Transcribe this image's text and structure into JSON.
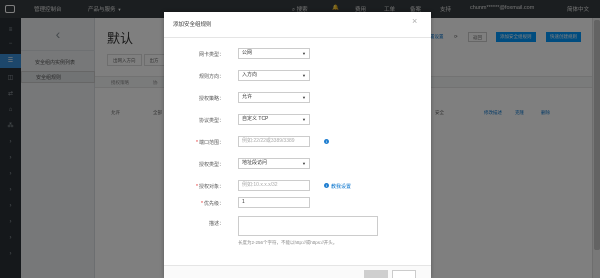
{
  "topbar": {
    "console": "管理控制台",
    "products": "产品与服务",
    "search": "搜索",
    "expense": "费用",
    "tickets": "工单",
    "record": "备案",
    "support": "支持",
    "account": "chunm******@foxmail.com",
    "lang": "简体中文"
  },
  "side": {
    "items": [
      "安全组内实例列表",
      "安全组规则"
    ]
  },
  "main": {
    "title": "默认",
    "tabs": [
      "出网入方向",
      "出方"
    ],
    "table_headers": [
      "授权策略",
      "协"
    ],
    "row": {
      "policy": "允许",
      "proto": "全部",
      "desc_tail": "安全"
    },
    "actions": [
      "修改描述",
      "克隆",
      "删除"
    ],
    "toolbar": {
      "settings": "置设置",
      "back": "返回",
      "add_rule": "添加安全组规则",
      "quick_add": "快速创建规则"
    }
  },
  "modal": {
    "title": "添加安全组规则",
    "fields": {
      "nic_type": {
        "label": "网卡类型：",
        "value": "公网",
        "required": false
      },
      "direction": {
        "label": "规则方向：",
        "value": "入方向",
        "required": false
      },
      "policy": {
        "label": "授权策略：",
        "value": "允许",
        "required": false
      },
      "protocol": {
        "label": "协议类型：",
        "value": "自定义 TCP",
        "required": false
      },
      "port": {
        "label": "端口范围：",
        "placeholder": "例如:22/22或3389/3389",
        "required": true
      },
      "auth_type": {
        "label": "授权类型：",
        "value": "地址段访问",
        "required": false
      },
      "auth_object": {
        "label": "授权对象：",
        "placeholder": "例如:10.x.x.x/32",
        "required": true,
        "link": "教我设置"
      },
      "priority": {
        "label": "优先级：",
        "value": "1",
        "required": true
      },
      "description": {
        "label": "描述：",
        "hint": "长度为2-256个字符，不能以http://或https://开头。",
        "required": false
      }
    }
  },
  "colors": {
    "accent": "#0099ff",
    "topbar": "#373d41",
    "rail": "#2b3136",
    "active_rail": "#3b8ed6",
    "required": "#e02020"
  }
}
